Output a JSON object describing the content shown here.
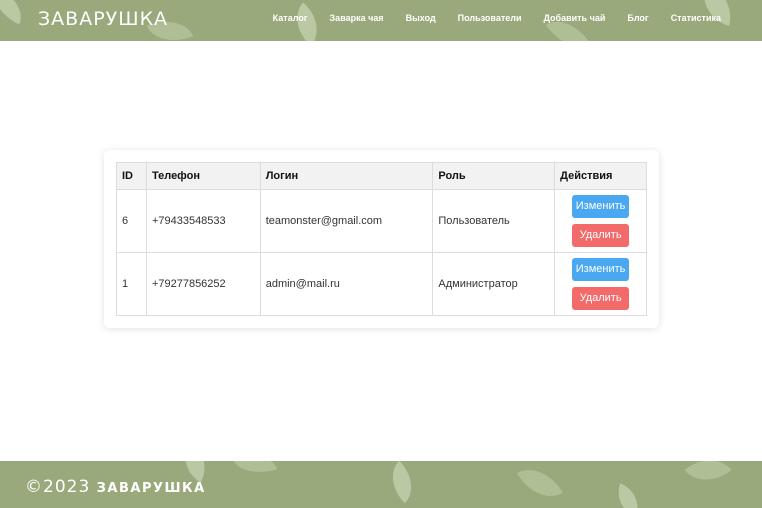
{
  "header": {
    "logo": "ЗАВАРУШКА",
    "nav": [
      "Каталог",
      "Заварка чая",
      "Выход",
      "Пользователи",
      "Добавить чай",
      "Блог",
      "Статистика"
    ]
  },
  "table": {
    "columns": [
      "ID",
      "Телефон",
      "Логин",
      "Роль",
      "Действия"
    ],
    "rows": [
      {
        "id": "6",
        "phone": "+79433548533",
        "login": "teamonster@gmail.com",
        "role": "Пользователь"
      },
      {
        "id": "1",
        "phone": "+79277856252",
        "login": "admin@mail.ru",
        "role": "Администратор"
      }
    ],
    "edit_label": "Изменить",
    "delete_label": "Удалить"
  },
  "footer": {
    "year": "©2023",
    "brand": "ЗАВАРУШКА"
  },
  "colors": {
    "header_bg": "#99a97c",
    "edit_button": "#4aa8f0",
    "delete_button": "#f26a6a"
  }
}
